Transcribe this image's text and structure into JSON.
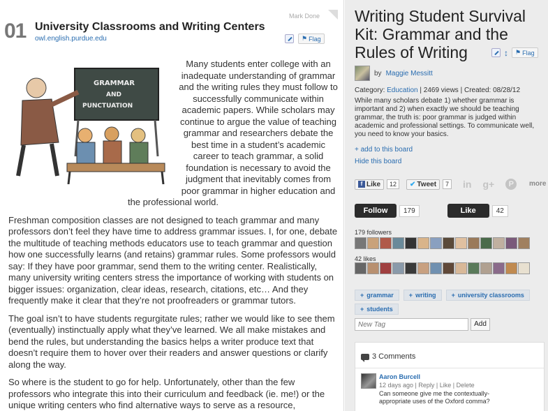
{
  "card": {
    "number": "01",
    "title": "University Classrooms and Writing Centers",
    "source": "owl.english.purdue.edu",
    "mark_done": "Mark Done",
    "flag": "Flag",
    "illustration_text": [
      "GRAMMAR",
      "AND",
      "PUNCTUATION"
    ],
    "paragraphs": [
      "Many students enter college with an inadequate understanding of grammar and the writing rules they must follow to successfully communicate within academic papers. While scholars may continue to argue the value of teaching grammar and researchers debate the best time in a student’s academic career to teach grammar, a solid foundation is necessary to avoid the judgment that inevitably comes from poor grammar in higher education and the professional world.",
      "Freshman composition classes are not designed to teach grammar and many professors don’t feel they have time to address grammar issues. I, for one, debate the multitude of teaching methods educators use to teach grammar and question how one successfully learns (and retains) grammar rules. Some professors would say: If they have poor grammar, send them to the writing center. Realistically, many university writing centers stress the importance of working with students on bigger issues: organization, clear ideas, research, citations, etc… And they frequently make it clear that they’re not proofreaders or grammar tutors.",
      "The goal isn’t to have students regurgitate rules; rather we would like to see them (eventually) instinctually apply what they’ve learned. We all make mistakes and bend the rules, but understanding the basics helps a writer produce text that doesn’t require them to hover over their readers and answer questions or clarify along the way.",
      "So where is the student to go for help. Unfortunately, other than the few professors who integrate this into their curriculum and feedback (ie. me!) or the unique writing centers who find alternative ways to serve as a resource,"
    ]
  },
  "sidebar": {
    "title": "Writing Student Survival Kit: Grammar and the Rules of Writing",
    "flag": "Flag",
    "by": "by",
    "author": "Maggie Messitt",
    "category_label": "Category:",
    "category": "Education",
    "views": "2469 views",
    "created": "Created: 08/28/12",
    "description": "While many scholars debate 1) whether grammar is important and 2) when exactly we should be teaching grammar, the truth is: poor grammar is judged within academic and professional settings. To communicate well, you need to know your basics.",
    "add_board": "+ add to this board",
    "hide_board": "Hide this board",
    "share": {
      "like_label": "Like",
      "like_count": "12",
      "tweet_label": "Tweet",
      "tweet_count": "7",
      "linkedin": "in",
      "gplus": "g+",
      "pinterest": "P",
      "more": "more"
    },
    "follow_label": "Follow",
    "follow_count": "179",
    "like_label": "Like",
    "like_count": "42",
    "followers_label": "179 followers",
    "likes_label": "42 likes",
    "tags": [
      "grammar",
      "writing",
      "university classrooms",
      "students"
    ],
    "new_tag_placeholder": "New Tag",
    "add_button": "Add",
    "comments": {
      "title": "3 Comments",
      "author": "Aaron Burcell",
      "meta": "12 days ago | Reply | Like | Delete",
      "text": "Can someone give me the contextually-appropriate uses of the Oxford comma?"
    }
  },
  "colors": {
    "link": "#2a6db0",
    "sidebar_bg": "#ececec",
    "dark_button": "#2b2b2b",
    "tag_bg": "#dfe4ea"
  }
}
